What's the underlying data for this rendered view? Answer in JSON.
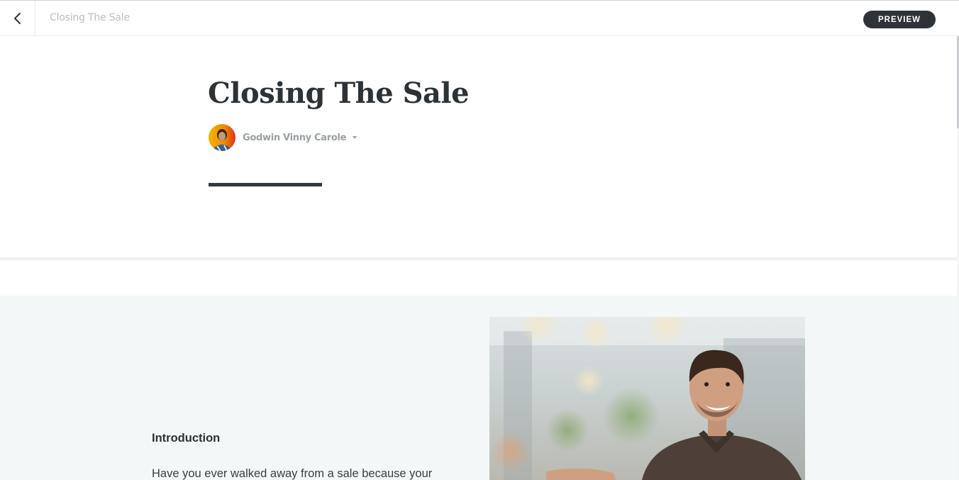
{
  "header": {
    "document_title": "Closing The Sale",
    "preview_label": "PREVIEW"
  },
  "article": {
    "title": "Closing The Sale",
    "author_name": "Godwin Vinny Carole"
  },
  "section": {
    "heading": "Introduction",
    "text": "Have you ever walked away from a sale because your"
  },
  "icons": {
    "back": "chevron-left-icon",
    "author_menu": "caret-down-icon"
  },
  "colors": {
    "preview_button_bg": "#2f3337",
    "title_underline": "#2f3a44",
    "section_bg": "#f4f7f8"
  }
}
